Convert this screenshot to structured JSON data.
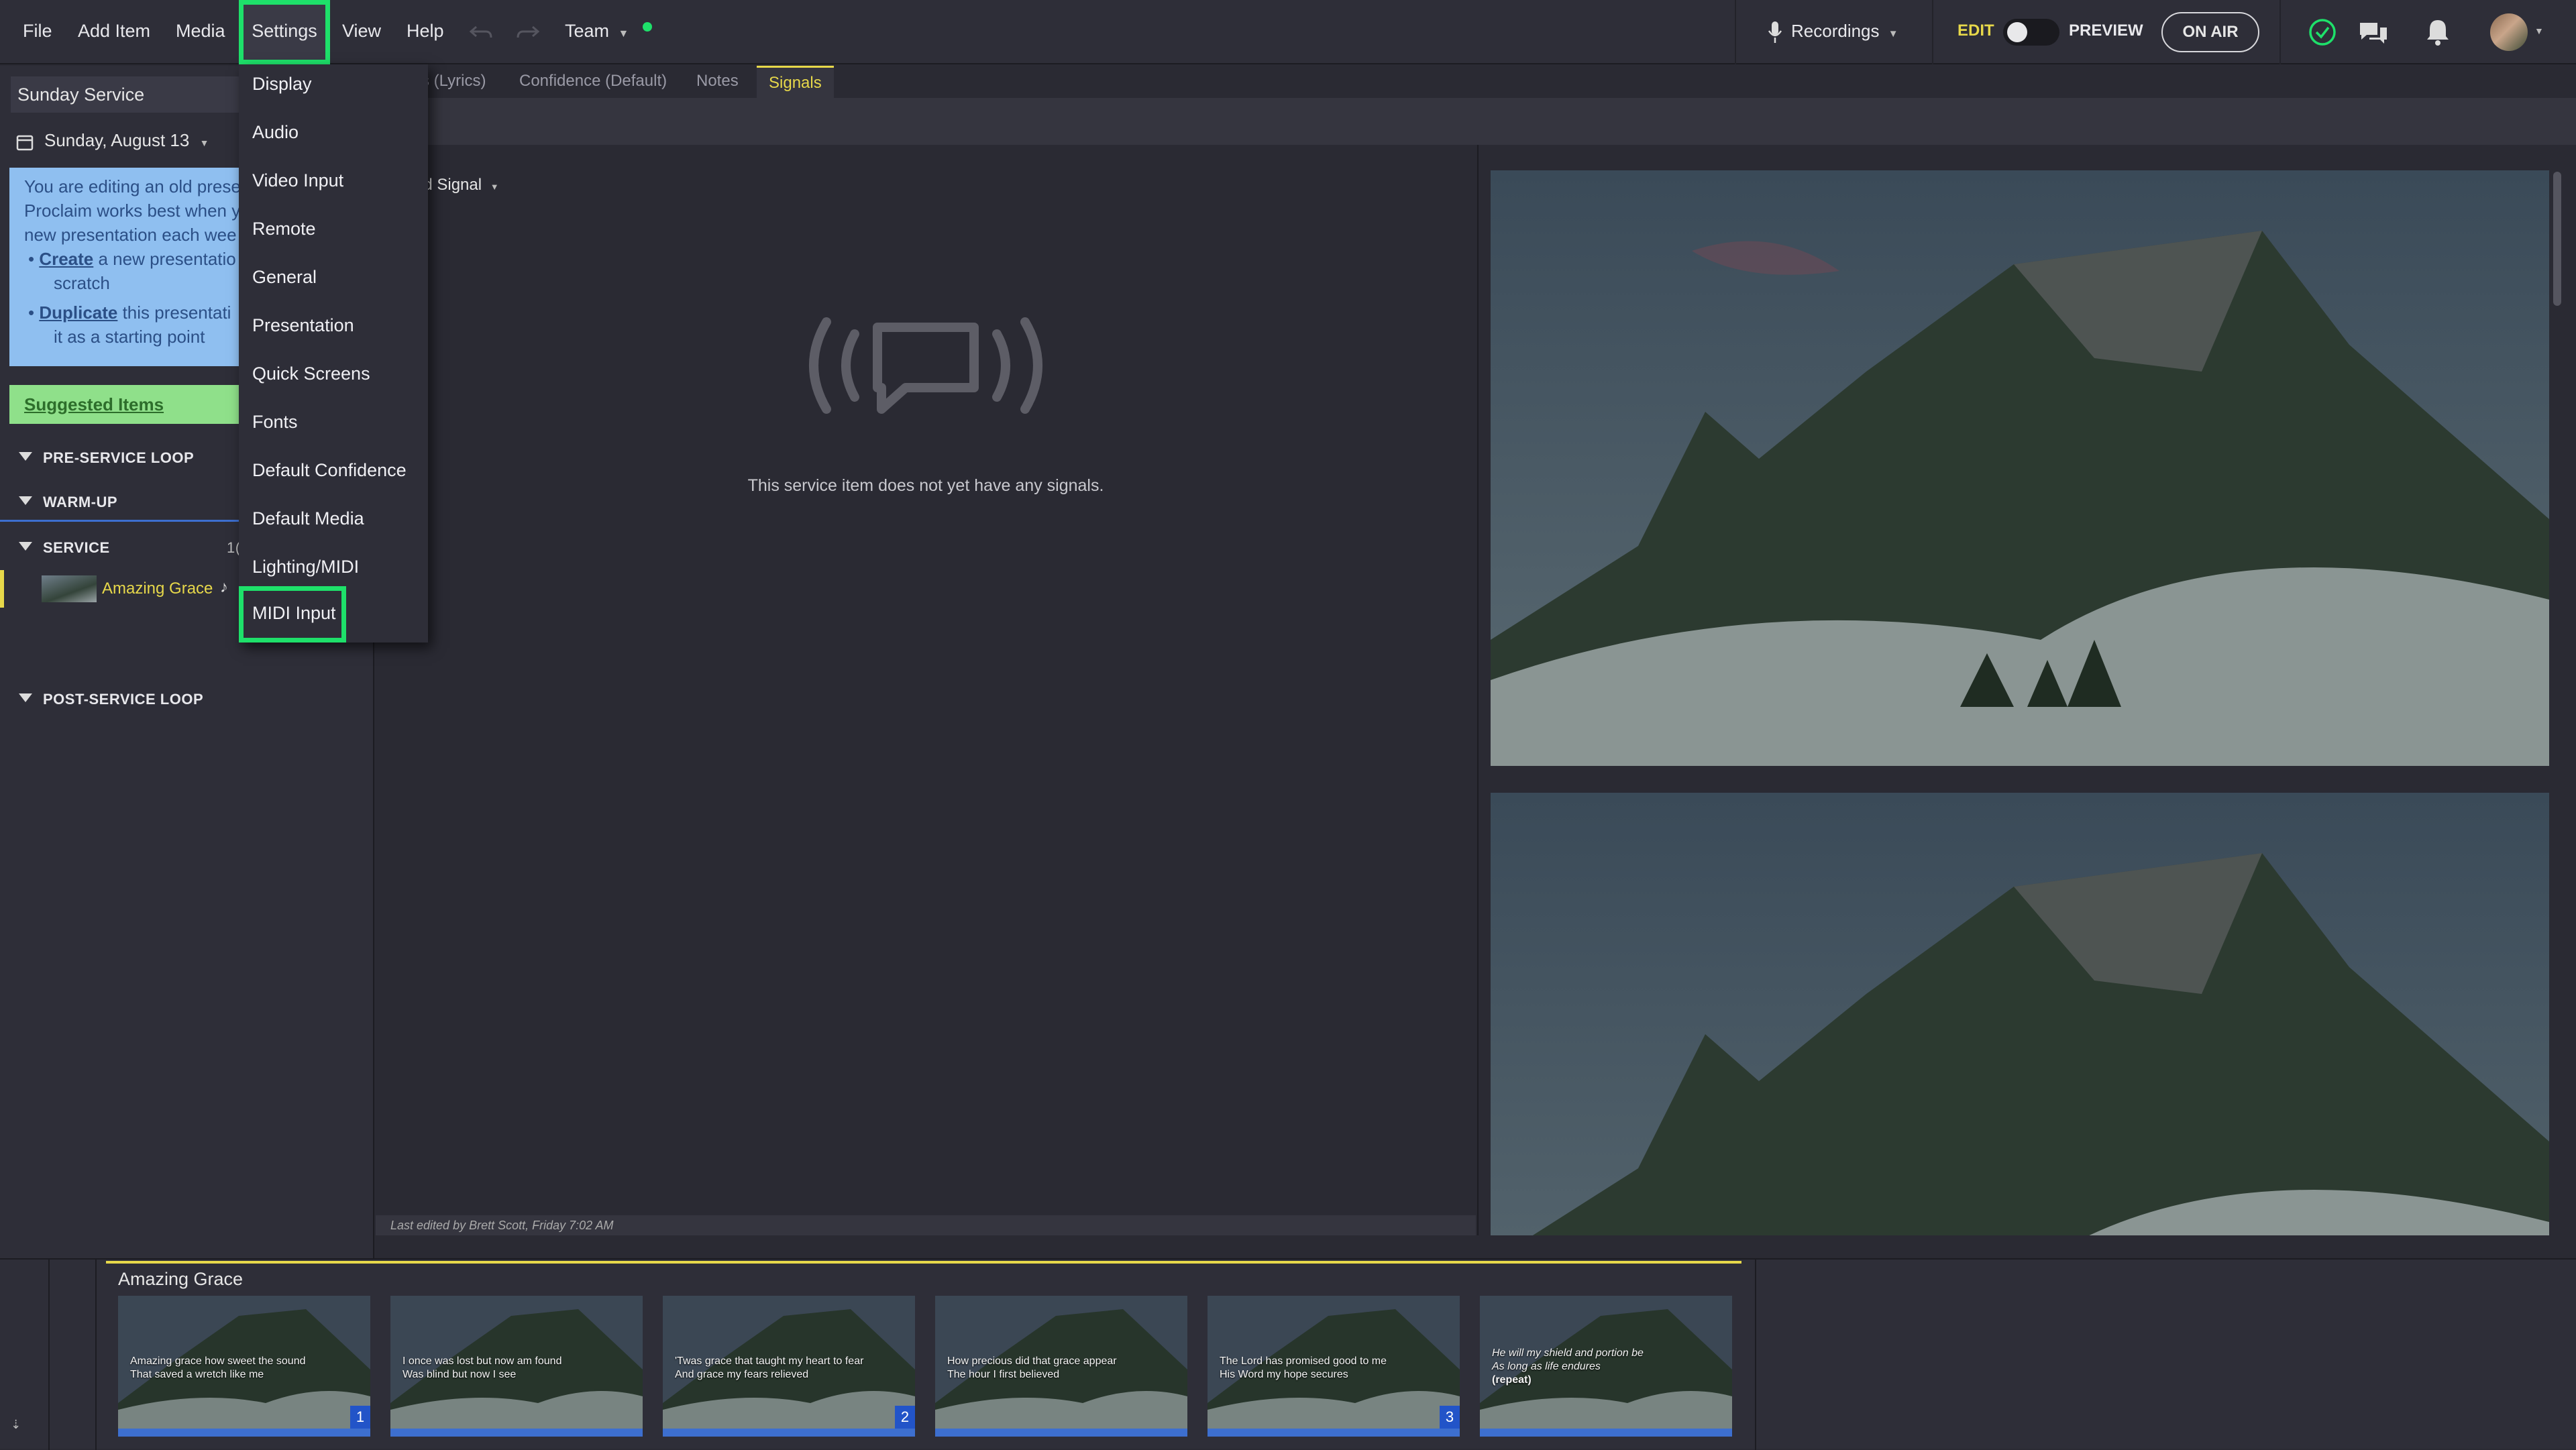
{
  "menubar": {
    "file": "File",
    "add_item": "Add Item",
    "media": "Media",
    "settings": "Settings",
    "view": "View",
    "help": "Help",
    "team": "Team",
    "recordings": "Recordings",
    "edit": "EDIT",
    "preview": "PREVIEW",
    "on_air": "ON AIR"
  },
  "sidebar": {
    "presentation": "Sunday Service",
    "date": "Sunday, August 13",
    "notice": {
      "line1": "You are editing an old prese",
      "line2": "Proclaim works best when y",
      "line3": "new presentation each wee",
      "create_link": "Create",
      "create_rest": " a new presentatio",
      "create_rest2": "scratch",
      "dup_link": "Duplicate",
      "dup_rest": " this presentati",
      "dup_rest2": "it as a starting point"
    },
    "suggested": "Suggested Items",
    "sections": {
      "preservice": "PRE-SERVICE LOOP",
      "warmup": "WARM-UP",
      "service": "SERVICE",
      "service_count": "1(",
      "postservice": "POST-SERVICE LOOP"
    },
    "service_item": "Amazing Grace",
    "service_item_icon": "♪"
  },
  "tabs": {
    "lyrics": "s (Lyrics)",
    "confidence": "Confidence (Default)",
    "notes": "Notes",
    "signals": "Signals"
  },
  "center": {
    "add_signal": "ld Signal",
    "empty_text": "This service item does not yet have any signals.",
    "last_edited": "Last edited by Brett Scott, Friday 7:02 AM"
  },
  "settings_menu": {
    "items": [
      "Display",
      "Audio",
      "Video Input",
      "Remote",
      "General",
      "Presentation",
      "Quick Screens",
      "Fonts",
      "Default Confidence",
      "Default Media",
      "Lighting/MIDI",
      "MIDI Input"
    ]
  },
  "bottom": {
    "song_title": "Amazing Grace",
    "slides": [
      {
        "l1": "Amazing grace how sweet the sound",
        "l2": "That saved a wretch like me",
        "l3": "",
        "num": "1"
      },
      {
        "l1": "I once was lost but now am found",
        "l2": "Was blind but now I see",
        "l3": "",
        "num": ""
      },
      {
        "l1": "'Twas grace that taught my heart to fear",
        "l2": "And grace my fears relieved",
        "l3": "",
        "num": "2"
      },
      {
        "l1": "How precious did that grace appear",
        "l2": "The hour I first believed",
        "l3": "",
        "num": ""
      },
      {
        "l1": "The Lord has promised good to me",
        "l2": "His Word my hope secures",
        "l3": "",
        "num": "3"
      },
      {
        "l1": "He will my shield and portion be",
        "l2": "As long as life endures",
        "l3": "(repeat)",
        "num": ""
      }
    ]
  },
  "colors": {
    "accent_green": "#1ee06a",
    "active_tab": "#e7d84a",
    "selected_item": "#e7d84a",
    "slide_bar_blue": "#3d6fcf",
    "notice_bg": "#8fbff0",
    "suggested_bg": "#8fe08a"
  }
}
